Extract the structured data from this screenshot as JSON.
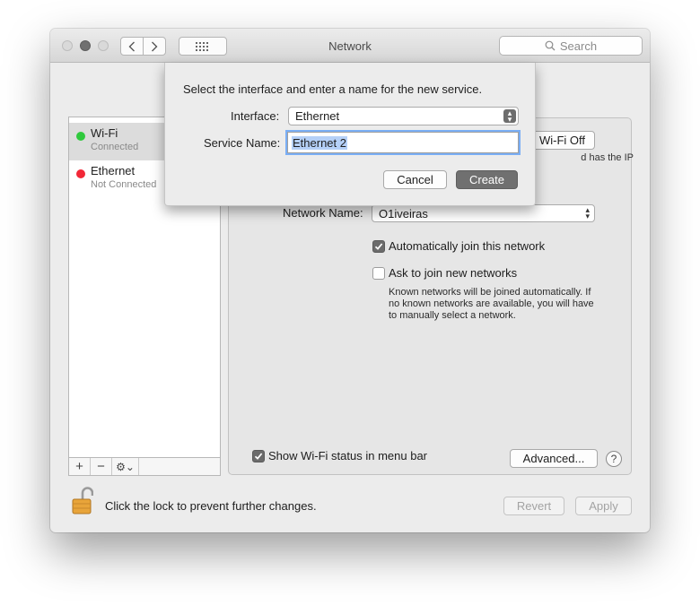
{
  "window": {
    "title": "Network",
    "search_placeholder": "Search"
  },
  "services": [
    {
      "name": "Wi-Fi",
      "status": "Connected",
      "status_color": "#2fc93d",
      "selected": true
    },
    {
      "name": "Ethernet",
      "status": "Not Connected",
      "status_color": "#f22837",
      "selected": false
    }
  ],
  "sidebar_tools": {
    "add": "+",
    "remove": "−",
    "gear": "⚙⌄"
  },
  "wifi_panel": {
    "turn_off_label": "Wi-Fi Off",
    "partial_status": "d has the IP",
    "network_name_label": "Network Name:",
    "network_name_value": "O1iveiras",
    "auto_join_label": "Automatically join this network",
    "auto_join_checked": true,
    "ask_join_label": "Ask to join new networks",
    "ask_join_checked": false,
    "ask_join_note": "Known networks will be joined automatically. If no known networks are available, you will have to manually select a network.",
    "show_status_label": "Show Wi-Fi status in menu bar",
    "show_status_checked": true,
    "advanced_label": "Advanced...",
    "help_label": "?"
  },
  "footer": {
    "lock_text": "Click the lock to prevent further changes.",
    "revert_label": "Revert",
    "apply_label": "Apply"
  },
  "sheet": {
    "prompt": "Select the interface and enter a name for the new service.",
    "interface_label": "Interface:",
    "interface_value": "Ethernet",
    "service_name_label": "Service Name:",
    "service_name_value": "Ethernet 2",
    "cancel_label": "Cancel",
    "create_label": "Create"
  }
}
